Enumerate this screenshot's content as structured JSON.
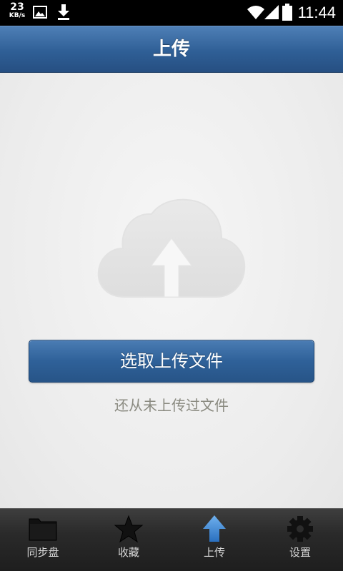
{
  "status_bar": {
    "speed_value": "23",
    "speed_unit": "KB/s",
    "time": "11:44",
    "icons": [
      "image-icon",
      "download-icon",
      "wifi-icon",
      "signal-icon",
      "battery-icon"
    ]
  },
  "header": {
    "title": "上传"
  },
  "main": {
    "cloud_icon": "cloud-upload-icon",
    "select_button_label": "选取上传文件",
    "empty_hint": "还从未上传过文件"
  },
  "tabbar": {
    "tabs": [
      {
        "label": "同步盘",
        "icon": "folder-icon"
      },
      {
        "label": "收藏",
        "icon": "star-icon"
      },
      {
        "label": "上传",
        "icon": "upload-arrow-icon"
      },
      {
        "label": "设置",
        "icon": "gear-icon"
      }
    ]
  },
  "colors": {
    "accent_blue": "#2f6199",
    "header_blue": "#3a6aa3",
    "tab_bar_bg": "#2a2a2a",
    "hint_text": "#8a8a80"
  }
}
